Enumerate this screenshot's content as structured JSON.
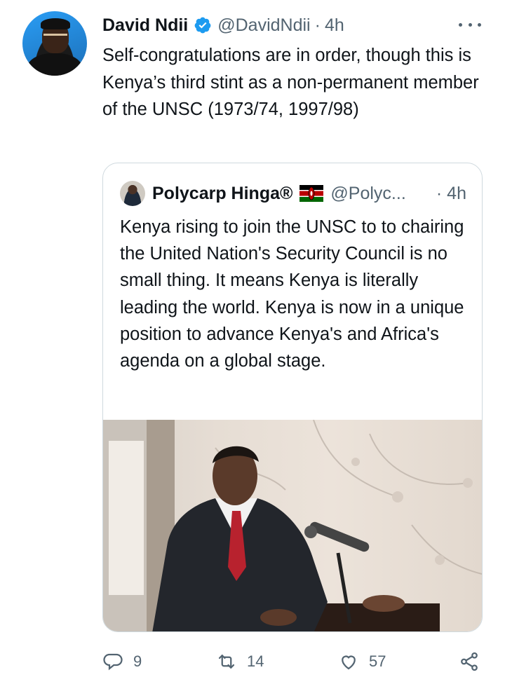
{
  "tweet": {
    "author": {
      "name": "David Ndii",
      "handle": "@DavidNdii",
      "time": "4h",
      "separator": "·"
    },
    "text": "Self-congratulations are in order, though this is Kenya’s third stint as a non-permanent member of the UNSC (1973/74, 1997/98)",
    "more_icon": "more-horizontal-icon"
  },
  "quoted_tweet": {
    "author": {
      "name": "Polycarp Hinga®",
      "handle": "@Polyc...",
      "time": "· 4h",
      "flag": "kenya-flag"
    },
    "text": "Kenya rising to join the UNSC to to chairing the United Nation's Security Council is no small thing. It means Kenya is literally leading the world. Kenya is now in a unique position to advance Kenya's and Africa's agenda on a global stage."
  },
  "actions": {
    "reply_count": "9",
    "retweet_count": "14",
    "like_count": "57"
  },
  "colors": {
    "text": "#0f1419",
    "secondary": "#536471",
    "verified": "#1d9bf0",
    "border": "#cfd9de"
  }
}
